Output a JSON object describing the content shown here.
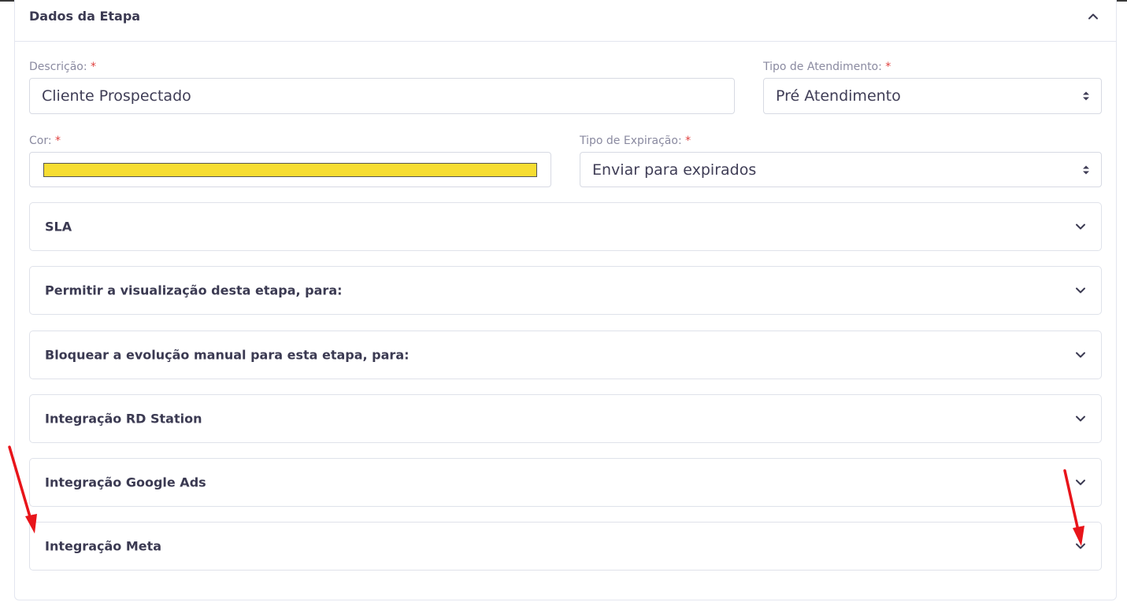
{
  "card": {
    "title": "Dados da Etapa"
  },
  "form": {
    "descricao": {
      "label": "Descrição:",
      "required": "*",
      "value": "Cliente Prospectado"
    },
    "tipo_atendimento": {
      "label": "Tipo de Atendimento:",
      "required": "*",
      "value": "Pré Atendimento"
    },
    "cor": {
      "label": "Cor:",
      "required": "*",
      "color": "#f6dd32"
    },
    "tipo_expiracao": {
      "label": "Tipo de Expiração:",
      "required": "*",
      "value": "Enviar para expirados"
    }
  },
  "panels": [
    {
      "title": "SLA"
    },
    {
      "title": "Permitir a visualização desta etapa, para:"
    },
    {
      "title": "Bloquear a evolução manual para esta etapa, para:"
    },
    {
      "title": "Integração RD Station"
    },
    {
      "title": "Integração Google Ads"
    },
    {
      "title": "Integração Meta"
    }
  ],
  "icons": {
    "collapse": "chevron-up-icon",
    "expand": "chevron-down-icon",
    "select": "select-arrows-icon",
    "annotation": "red-arrow-icon"
  },
  "colors": {
    "annotation_arrow": "#e8141a",
    "required": "#e0413f"
  }
}
